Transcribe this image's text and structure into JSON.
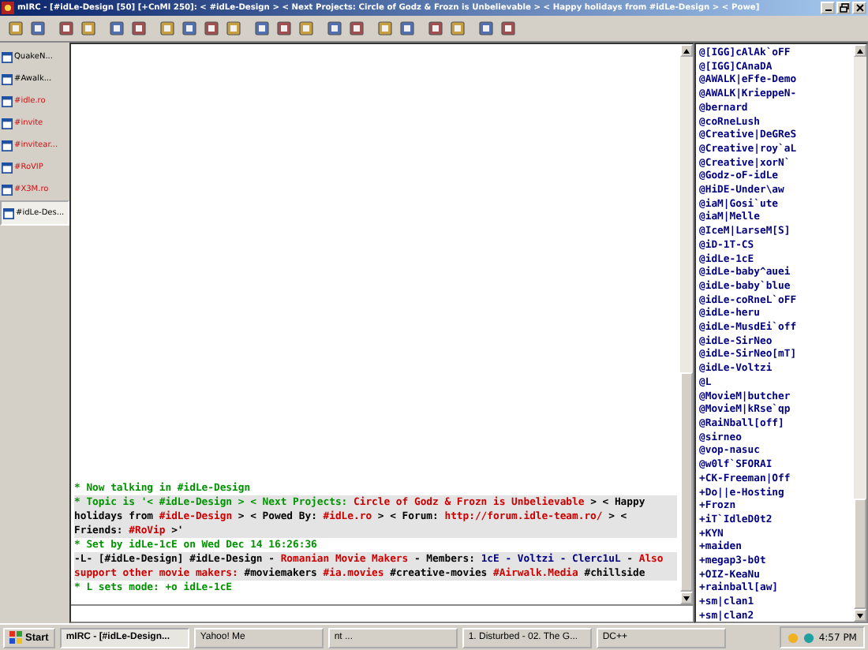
{
  "window": {
    "title": "mIRC - [#idLe-Design [50] [+CnMl 250]: < #idLe-Design > < Next Projects: Circle of Godz & Frozn is Unbelievable > < Happy holidays from #idLe-Design > < Powe]"
  },
  "switchbar": {
    "items": [
      {
        "label": "QuakeN...",
        "activity": false,
        "selected": false
      },
      {
        "label": "#Awalk...",
        "activity": false,
        "selected": false
      },
      {
        "label": "#idle.ro",
        "activity": true,
        "selected": false
      },
      {
        "label": "#invite",
        "activity": true,
        "selected": false
      },
      {
        "label": "#invitear...",
        "activity": true,
        "selected": false
      },
      {
        "label": "#RoVIP",
        "activity": true,
        "selected": false
      },
      {
        "label": "#X3M.ro",
        "activity": true,
        "selected": false
      },
      {
        "label": "#idLe-Des...",
        "activity": false,
        "selected": true
      }
    ]
  },
  "chat": {
    "lines": [
      {
        "highlight": false,
        "segments": [
          {
            "text": "* Now talking in #idLe-Design",
            "color": "#009300"
          }
        ]
      },
      {
        "highlight": true,
        "segments": [
          {
            "text": "* Topic is '< #idLe-Design > < Next Projects: ",
            "color": "#009300"
          },
          {
            "text": "Circle of Godz & Frozn is Unbelievable",
            "color": "#cc0000"
          },
          {
            "text": " > < Happy holidays from ",
            "color": "#000000"
          },
          {
            "text": "#idLe-Design",
            "color": "#cc0000"
          },
          {
            "text": " > < Powed By: ",
            "color": "#000000"
          },
          {
            "text": "#idLe.ro",
            "color": "#cc0000"
          },
          {
            "text": " > < Forum: ",
            "color": "#000000"
          },
          {
            "text": "http://forum.idle-team.ro/",
            "color": "#cc0000"
          },
          {
            "text": " > < Friends: ",
            "color": "#000000"
          },
          {
            "text": "#RoVip",
            "color": "#cc0000"
          },
          {
            "text": " >'",
            "color": "#000000"
          }
        ]
      },
      {
        "highlight": false,
        "segments": [
          {
            "text": "* Set by idLe-1cE on Wed Dec 14 16:26:36",
            "color": "#009300"
          }
        ]
      },
      {
        "highlight": true,
        "segments": [
          {
            "text": "-L- [#idLe-Design] #idLe-Design - ",
            "color": "#000000"
          },
          {
            "text": "Romanian Movie Makers",
            "color": "#cc0000"
          },
          {
            "text": " - Members: ",
            "color": "#000000"
          },
          {
            "text": "1cE - Voltzi - Clerc1uL",
            "color": "#00007f"
          },
          {
            "text": " - ",
            "color": "#000000"
          },
          {
            "text": "Also support other movie makers:",
            "color": "#cc0000"
          },
          {
            "text": " #moviemakers ",
            "color": "#000000"
          },
          {
            "text": "#ia.movies",
            "color": "#cc0000"
          },
          {
            "text": " #creative-movies ",
            "color": "#000000"
          },
          {
            "text": "#Airwalk.Media",
            "color": "#cc0000"
          },
          {
            "text": " #chillside",
            "color": "#000000"
          }
        ]
      },
      {
        "highlight": false,
        "segments": [
          {
            "text": "* L sets mode: +o idLe-1cE",
            "color": "#009300"
          }
        ]
      }
    ]
  },
  "nicklist": [
    "@[IGG]cAlAk`oFF",
    "@[IGG]CAnaDA",
    "@AWALK|eFfe-Demo",
    "@AWALK|KrieppeN-",
    "@bernard",
    "@coRneLush",
    "@Creative|DeGReS",
    "@Creative|roy`aL",
    "@Creative|xorN`",
    "@Godz-oF-idLe",
    "@HiDE-Under\\aw",
    "@iaM|Gosi`ute",
    "@iaM|Melle",
    "@IceM|LarseM[S]",
    "@iD-1T-CS",
    "@idLe-1cE",
    "@idLe-baby^auei",
    "@idLe-baby`blue",
    "@idLe-coRneL`oFF",
    "@idLe-heru",
    "@idLe-MusdEi`off",
    "@idLe-SirNeo",
    "@idLe-SirNeo[mT]",
    "@idLe-Voltzi",
    "@L",
    "@MovieM|butcher",
    "@MovieM|kRse`qp",
    "@RaiNball[off]",
    "@sirneo",
    "@vop-nasuc",
    "@w0lf`SFORAI",
    "+CK-Freeman|Off",
    "+Do||e-Hosting",
    "+Frozn",
    "+iT`IdleD0t2",
    "+KYN",
    "+maiden",
    "+megap3-b0t",
    "+OIZ-KeaNu",
    "+rainball[aw]",
    "+sm|clan1",
    "+sm|clan2"
  ],
  "taskbar": {
    "start": "Start",
    "tasks": [
      {
        "label": "mIRC - [#idLe-Design...",
        "selected": true
      },
      {
        "label": "Yahoo! Me",
        "selected": false
      },
      {
        "label": "nt ...",
        "selected": false
      },
      {
        "label": "1. Disturbed - 02. The G...",
        "selected": false
      },
      {
        "label": "DC++",
        "selected": false
      }
    ],
    "clock": "4:57 PM"
  }
}
